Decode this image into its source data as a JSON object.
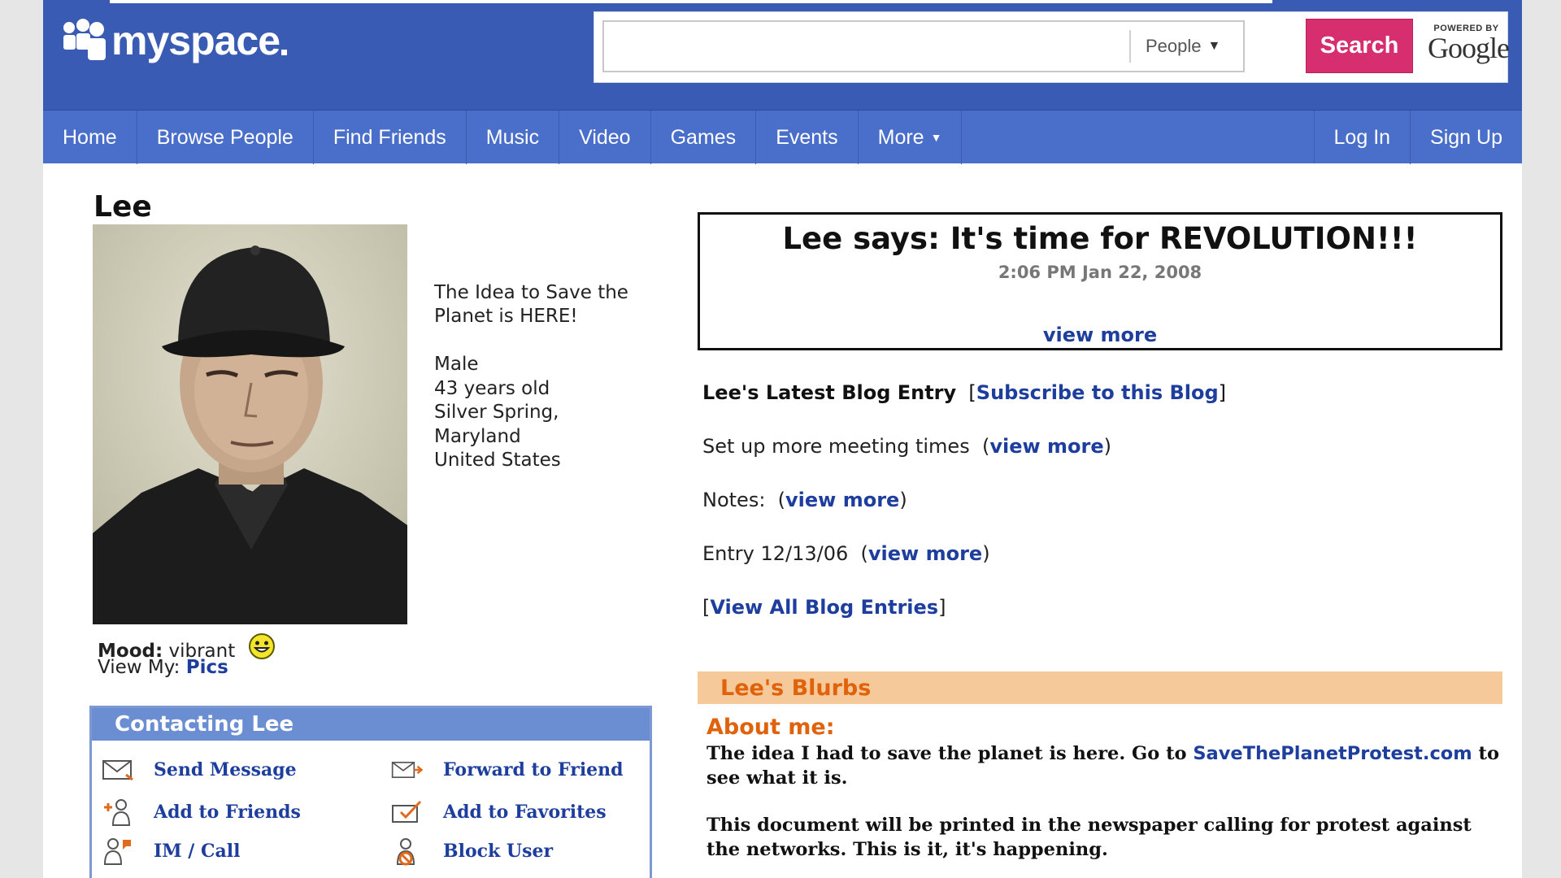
{
  "brand": {
    "logo_text": "myspace"
  },
  "search": {
    "value": "",
    "placeholder": "",
    "scope": "People",
    "button": "Search",
    "powered_by": "POWERED BY",
    "google": "Google"
  },
  "nav": {
    "items": [
      "Home",
      "Browse People",
      "Find Friends",
      "Music",
      "Video",
      "Games",
      "Events",
      "More"
    ],
    "right": [
      "Log In",
      "Sign Up"
    ]
  },
  "profile": {
    "name": "Lee",
    "headline": "The Idea to Save the Planet is HERE!",
    "details": [
      "Male",
      "43 years old",
      "Silver Spring,",
      "Maryland",
      "United States"
    ],
    "mood_label": "Mood:",
    "mood_value": "vibrant",
    "view_my_label": "View My:",
    "view_my_link": "Pics"
  },
  "contact": {
    "title": "Contacting Lee",
    "items": [
      "Send Message",
      "Forward to Friend",
      "Add to Friends",
      "Add to Favorites",
      "IM / Call",
      "Block User"
    ]
  },
  "status": {
    "text": "Lee says: It's time for REVOLUTION!!!",
    "time": "2:06 PM Jan 22, 2008",
    "view_more": "view more"
  },
  "blog": {
    "title": "Lee's Latest Blog Entry",
    "subscribe": "Subscribe to this Blog",
    "entries": [
      {
        "text": "Set up more meeting times",
        "link": "view more"
      },
      {
        "text": "Notes:",
        "link": "view more"
      },
      {
        "text": "Entry 12/13/06",
        "link": "view more"
      }
    ],
    "view_all": "View All Blog Entries"
  },
  "blurbs": {
    "title": "Lee's Blurbs",
    "about_heading": "About me:",
    "about_p1_before": "The idea I had to save the planet is here. Go to",
    "about_p1_link": "SaveThePlanetProtest.com",
    "about_p1_after": "to see what it is.",
    "about_p2": "This document will be printed in the newspaper calling for protest against the networks. This is it, it's happening."
  },
  "colors": {
    "header_blue": "#3a5bb3",
    "nav_blue": "#4a6fca",
    "search_pink": "#d62e6e",
    "link_blue": "#1e3e9e",
    "blurbs_bar": "#f6c99a",
    "blurbs_orange": "#e0620b"
  }
}
